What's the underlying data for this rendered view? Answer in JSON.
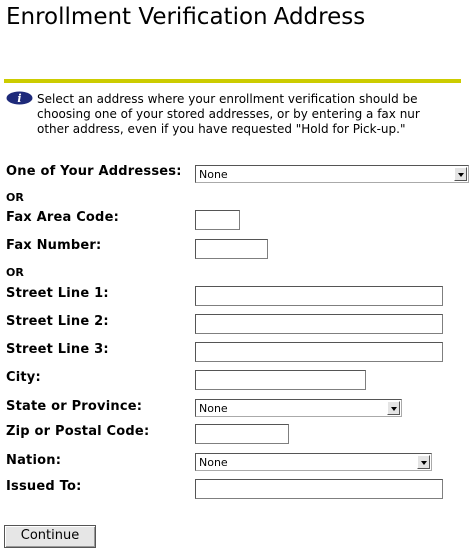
{
  "page": {
    "title_part1": "Enrollment Verification",
    "title_part2": "Address"
  },
  "info": {
    "icon": "info-icon",
    "text": "Select an address where your enrollment verification should be\nchoosing one of your stored addresses, or by entering a fax nur\nother address, even if you have requested \"Hold for Pick-up.\""
  },
  "form": {
    "addresses_label": "One of Your Addresses:",
    "addresses_value": "None",
    "or1": "OR",
    "fax_area_label": "Fax Area Code:",
    "fax_area_value": "",
    "fax_number_label": "Fax Number:",
    "fax_number_value": "",
    "or2": "OR",
    "street1_label": "Street Line 1:",
    "street1_value": "",
    "street2_label": "Street Line 2:",
    "street2_value": "",
    "street3_label": "Street Line 3:",
    "street3_value": "",
    "city_label": "City:",
    "city_value": "",
    "state_label": "State or Province:",
    "state_value": "None",
    "zip_label": "Zip or Postal Code:",
    "zip_value": "",
    "nation_label": "Nation:",
    "nation_value": "None",
    "issued_label": "Issued To:",
    "issued_value": ""
  },
  "actions": {
    "continue_label": "Continue"
  },
  "colors": {
    "rule": "#cccc00",
    "icon": "#1e2a7a"
  }
}
